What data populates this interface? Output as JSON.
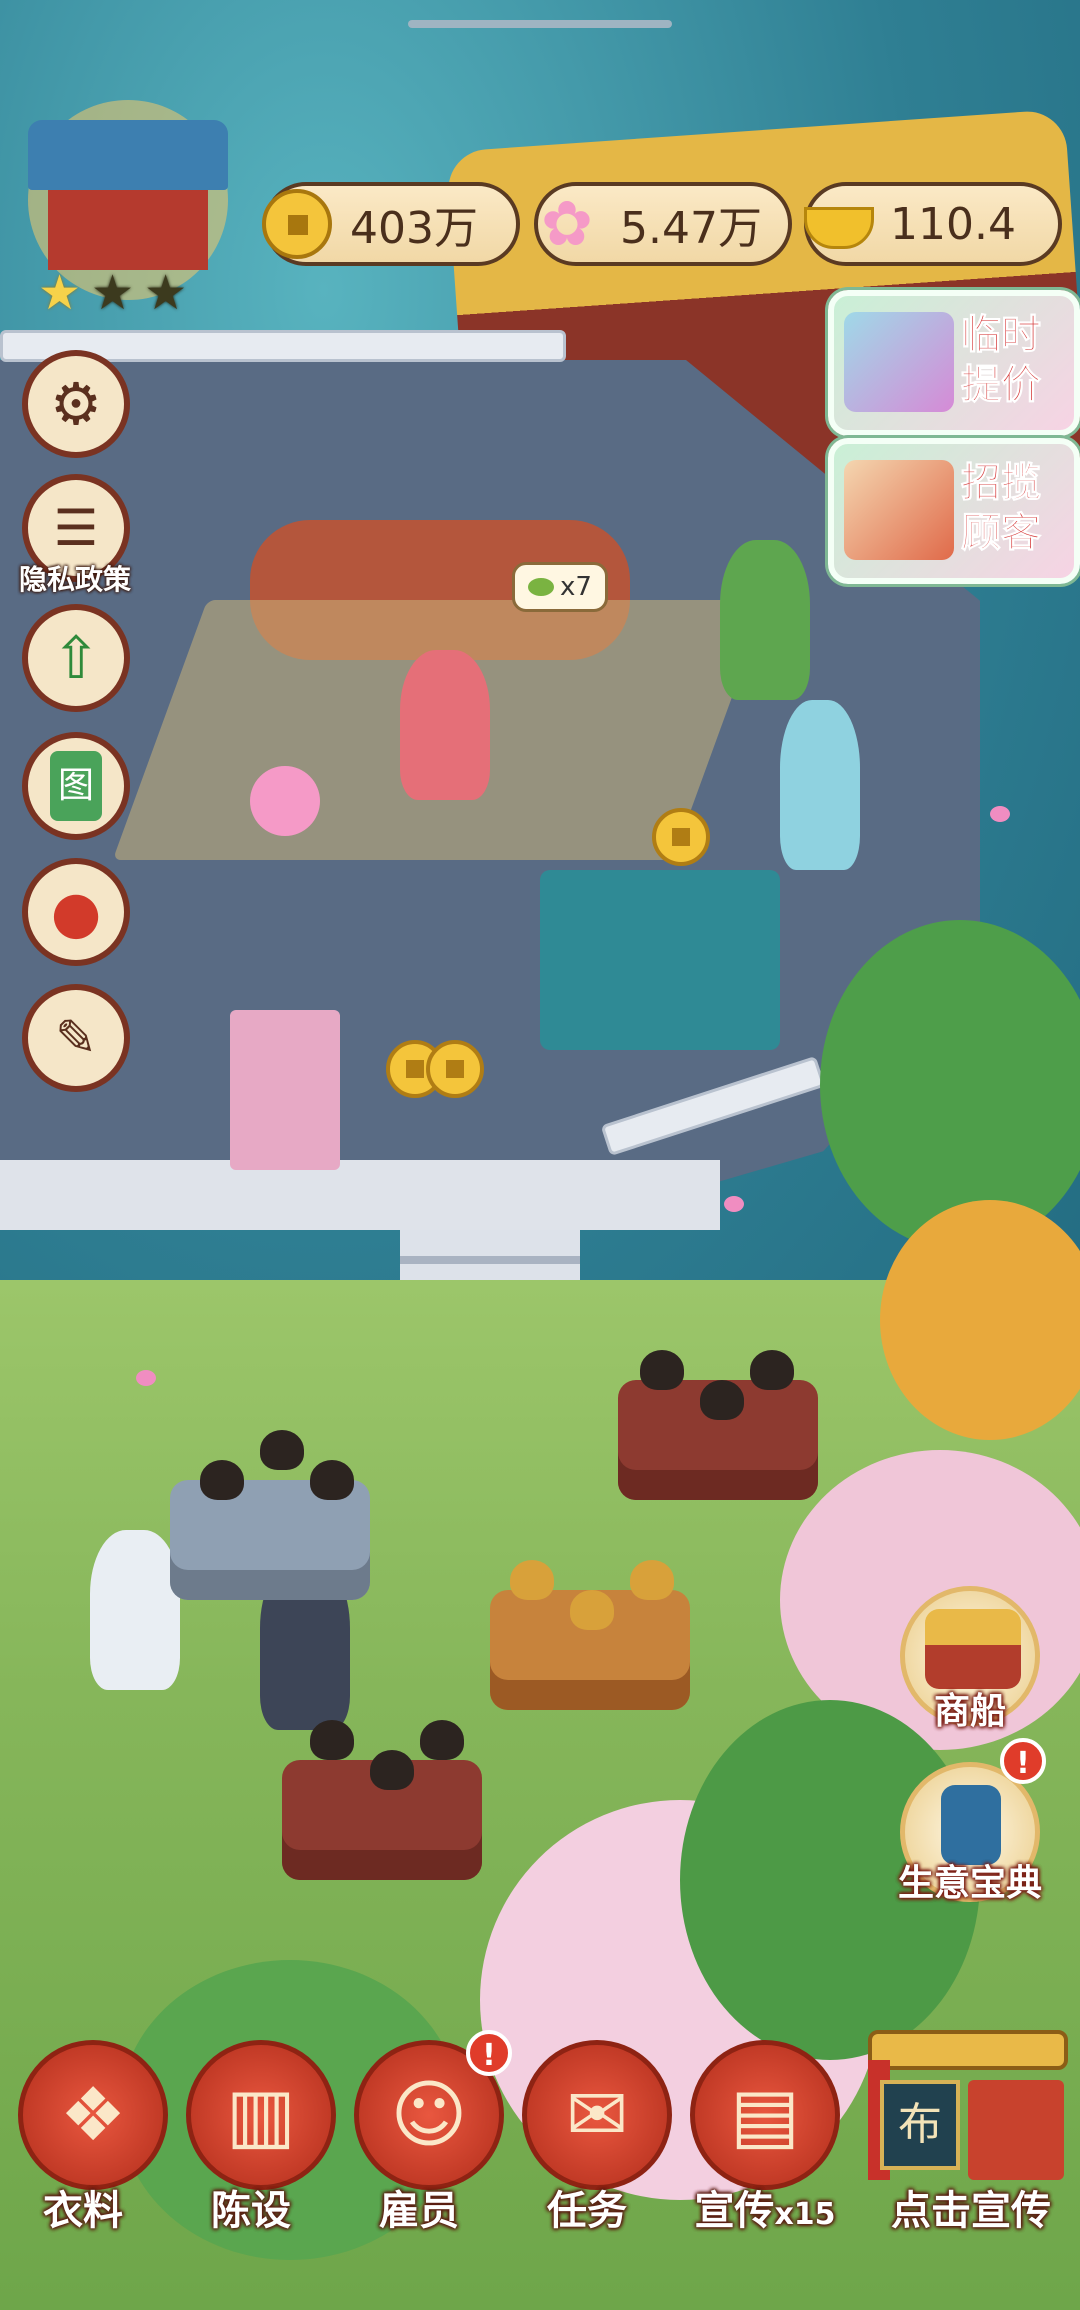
{
  "resources": {
    "coins": "403万",
    "blossoms": "5.47万",
    "gold": "110.4"
  },
  "shop": {
    "stars_total": 3,
    "stars_earned": 1
  },
  "promos": {
    "price_boost": "临时提价",
    "attract_customers": "招揽顾客"
  },
  "left_menu": {
    "settings_icon": "gear-icon",
    "privacy_label": "隐私政策",
    "upgrade_icon": "house-arrow-icon",
    "catalog_glyph": "图",
    "bag_icon": "lucky-bag-icon",
    "decorate_icon": "brush-icon"
  },
  "scene": {
    "bubble_count": "x7"
  },
  "right_menu": {
    "merchant_ship": "商船",
    "business_guide": "生意宝典",
    "guide_alert": "!"
  },
  "bottom_bar": {
    "fabric": "衣料",
    "furnish": "陈设",
    "staff": "雇员",
    "staff_alert": "!",
    "tasks": "任务",
    "promote": "宣传",
    "promote_count": "x15",
    "click_promote": "点击宣传",
    "gate_sign_glyph": "布"
  },
  "colors": {
    "accent_red": "#c23a26",
    "panel_cream": "#fbe9c6",
    "water": "#2f7f93",
    "lawn": "#86b65a"
  }
}
